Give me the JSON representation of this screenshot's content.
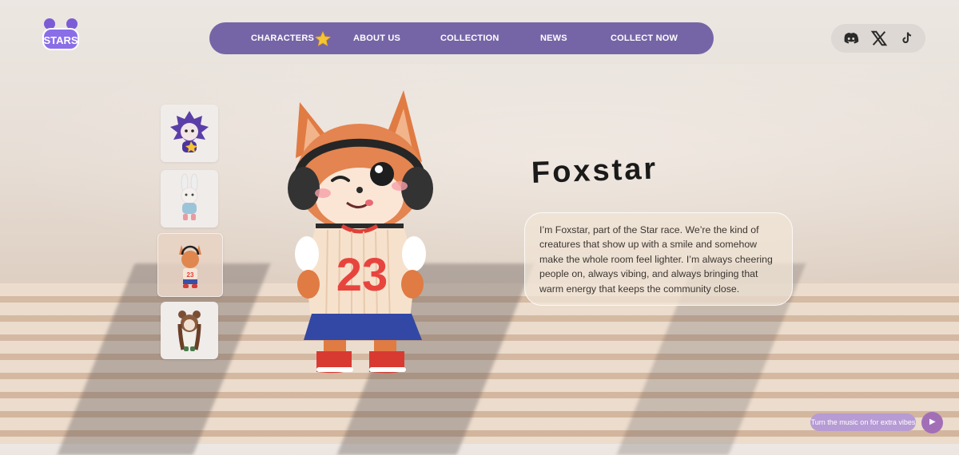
{
  "brand": {
    "logo_text": "STARS"
  },
  "nav": {
    "items": [
      {
        "label": "CHARACTERS"
      },
      {
        "label": "ABOUT US"
      },
      {
        "label": "COLLECTION"
      },
      {
        "label": "NEWS"
      },
      {
        "label": "COLLECT NOW"
      }
    ],
    "active_index": 0,
    "color": "#7565a6"
  },
  "socials": [
    {
      "icon": "discord-icon"
    },
    {
      "icon": "x-icon"
    },
    {
      "icon": "tiktok-icon"
    }
  ],
  "thumbnails": [
    {
      "icon": "hedgehog-character-icon"
    },
    {
      "icon": "bunny-character-icon"
    },
    {
      "icon": "fox-character-icon",
      "active": true
    },
    {
      "icon": "bear-character-icon"
    }
  ],
  "character": {
    "name": "Foxstar",
    "jersey_number": "23",
    "bio": "I’m Foxstar, part of the Star race. We’re the kind of creatures that show up with a smile and somehow make the whole room feel lighter. I’m always cheering people on, always vibing, and always bringing that warm energy that keeps the community close."
  },
  "music": {
    "prompt": "Turn the music on for extra vibes",
    "play_symbol": "▶"
  }
}
